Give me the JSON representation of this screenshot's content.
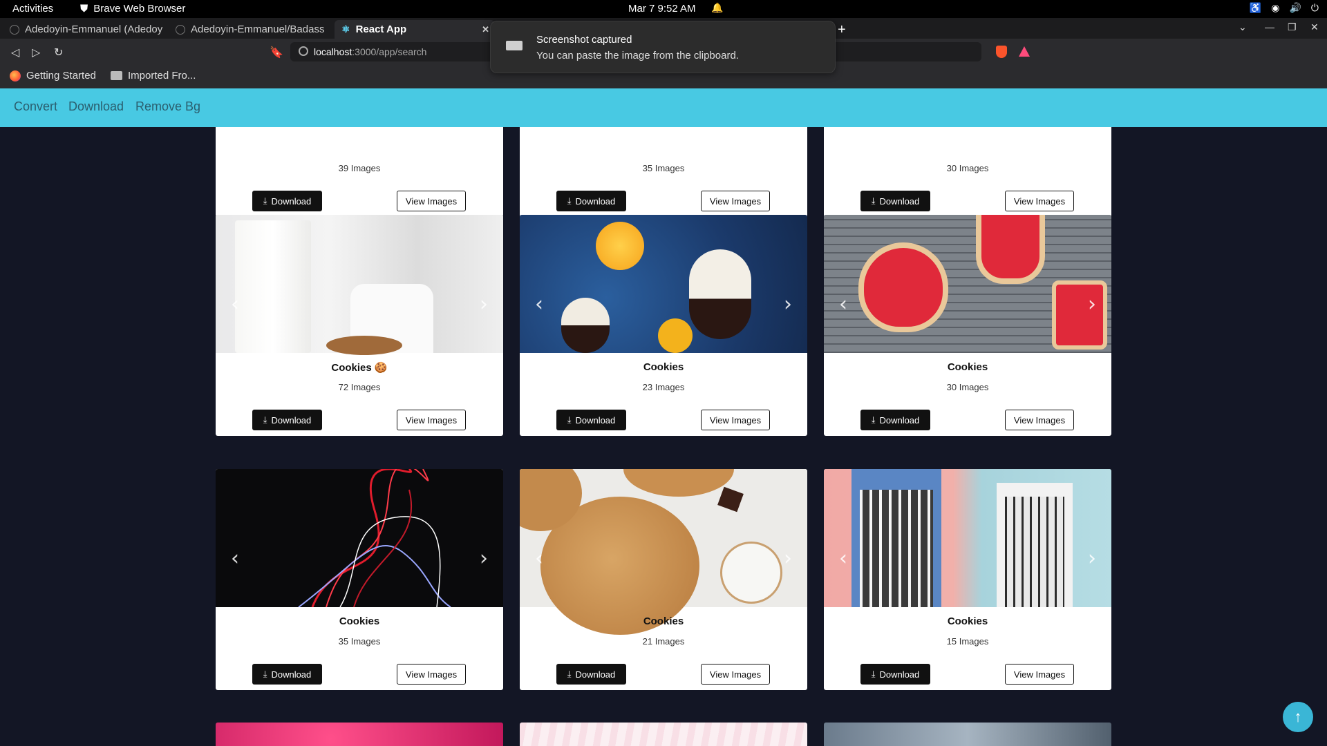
{
  "system": {
    "activities": "Activities",
    "app_name": "Brave Web Browser",
    "clock": "Mar 7  9:52 AM"
  },
  "browser": {
    "tabs": [
      {
        "label": "Adedoyin-Emmanuel (Adedoy"
      },
      {
        "label": "Adedoyin-Emmanuel/Badass"
      },
      {
        "label": "React App"
      }
    ],
    "url_host": "localhost",
    "url_path": ":3000/app/search",
    "bookmarks": [
      {
        "label": "Getting Started"
      },
      {
        "label": "Imported Fro..."
      }
    ]
  },
  "notification": {
    "title": "Screenshot captured",
    "body": "You can paste the image from the clipboard."
  },
  "app_nav": {
    "links": [
      "Convert",
      "Download",
      "Remove Bg"
    ]
  },
  "gallery": {
    "download_label": "Download",
    "view_label": "View Images",
    "top_row": [
      {
        "count": "39 Images"
      },
      {
        "count": "35 Images"
      },
      {
        "count": "30 Images"
      }
    ],
    "cards": [
      {
        "title": "Cookies 🍪",
        "count": "72 Images",
        "theme": "milk"
      },
      {
        "title": "Cookies",
        "count": "23 Images",
        "theme": "pears"
      },
      {
        "title": "Cookies",
        "count": "30 Images",
        "theme": "stockings"
      },
      {
        "title": "Cookies",
        "count": "35 Images",
        "theme": "lights"
      },
      {
        "title": "Cookies",
        "count": "21 Images",
        "theme": "choc-chip"
      },
      {
        "title": "Cookies",
        "count": "15 Images",
        "theme": "doors"
      }
    ]
  },
  "colors": {
    "page_bg": "#131625",
    "app_nav_bg": "#48c9e3",
    "accent": "#3ab6d6"
  }
}
